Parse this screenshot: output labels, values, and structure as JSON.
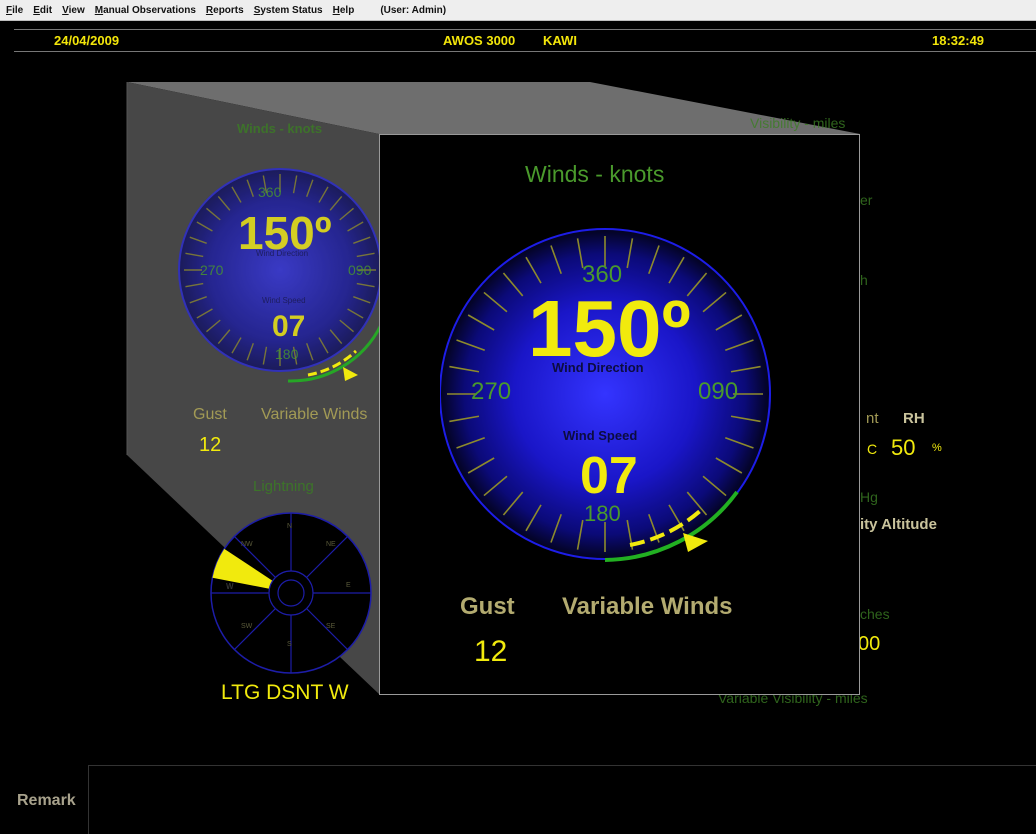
{
  "menu": {
    "items": [
      "File",
      "Edit",
      "View",
      "Manual Observations",
      "Reports",
      "System Status",
      "Help"
    ],
    "user": "(User: Admin)"
  },
  "status": {
    "date": "24/04/2009",
    "system": "AWOS 3000",
    "station": "KAWI",
    "time": "18:32:49"
  },
  "background": {
    "winds_title": "Winds - knots",
    "direction_value": "150º",
    "direction_label": "Wind Direction",
    "speed_label": "Wind Speed",
    "speed_value": "07",
    "dial_labels": {
      "n": "360",
      "w": "270",
      "e": "090",
      "s": "180"
    },
    "gust_label": "Gust",
    "gust_value": "12",
    "variable_label": "Variable Winds",
    "lightning_title": "Lightning",
    "lightning_sectors": {
      "n": "N",
      "ne": "NE",
      "e": "E",
      "se": "SE",
      "s": "S",
      "sw": "SW",
      "w": "W",
      "nw": "NW"
    },
    "lightning_active": "W",
    "ltg_text": "LTG DSNT W",
    "visibility_title": "Visibility - miles",
    "frag_er": "er",
    "frag_h": "h",
    "frag_nt": "nt",
    "rh_label": "RH",
    "temp_unit": "C",
    "rh_value": "50",
    "rh_unit": "%",
    "frag_hg": "Hg",
    "density_altitude_frag": "ity Altitude",
    "frag_ches": "ches",
    "frag_00": "00",
    "variable_visibility": "Variable Visibility - miles"
  },
  "popup": {
    "winds_title": "Winds - knots",
    "direction_value": "150º",
    "direction_label": "Wind Direction",
    "speed_label": "Wind Speed",
    "speed_value": "07",
    "dial_labels": {
      "n": "360",
      "w": "270",
      "e": "090",
      "s": "180"
    },
    "gust_label": "Gust",
    "gust_value": "12",
    "variable_label": "Variable Winds"
  },
  "remark": {
    "label": "Remark"
  },
  "colors": {
    "title_green": "#4a9a2c",
    "value_yellow": "#f1ea0d",
    "label_olive": "#a29a55",
    "dial_blue": "#1a14c8",
    "arc_green": "#22b022"
  }
}
